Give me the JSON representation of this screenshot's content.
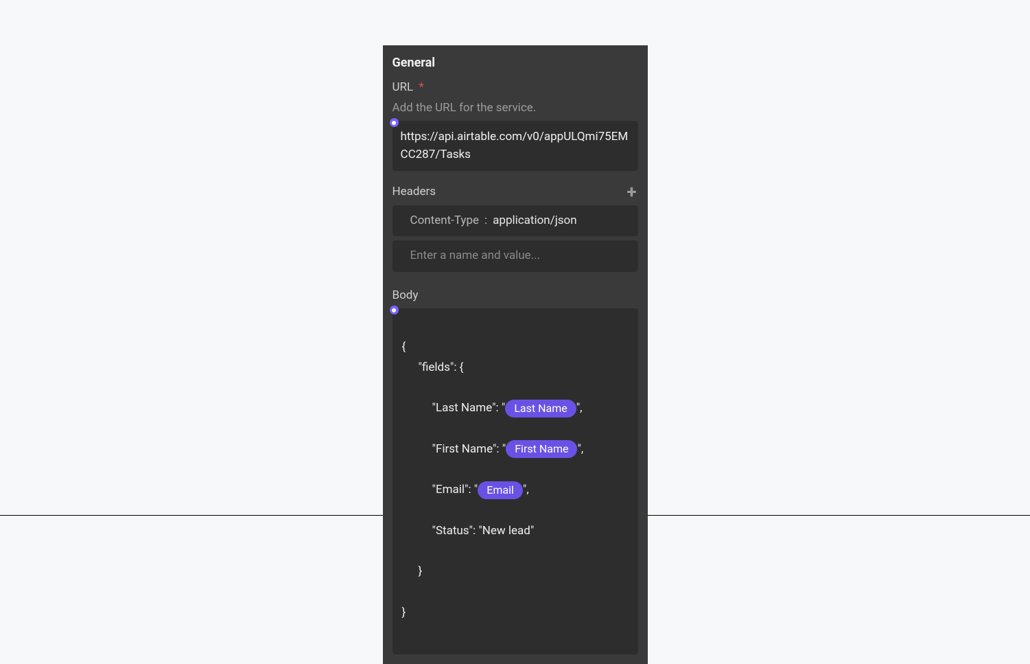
{
  "panel": {
    "title": "General",
    "url": {
      "label": "URL",
      "required_marker": "*",
      "help": "Add the URL for the service.",
      "value": "https://api.airtable.com/v0/appULQmi75EMCC287/Tasks"
    },
    "headers": {
      "label": "Headers",
      "rows": [
        {
          "name": "Content-Type",
          "sep": ":",
          "value": "application/json"
        }
      ],
      "placeholder": "Enter a name and value..."
    },
    "body": {
      "label": "Body",
      "lines": {
        "open": "{",
        "fields_open": "\"fields\": {",
        "last_name_pre": "\"Last Name\": \"",
        "last_name_pill": "Last Name",
        "last_name_post": "\",",
        "first_name_pre": "\"First Name\": \"",
        "first_name_pill": "First Name",
        "first_name_post": "\",",
        "email_pre": "\"Email\": \"",
        "email_pill": "Email",
        "email_post": "\",",
        "status_line": "\"Status\": \"New lead\"",
        "fields_close": "}",
        "close": "}"
      }
    }
  }
}
